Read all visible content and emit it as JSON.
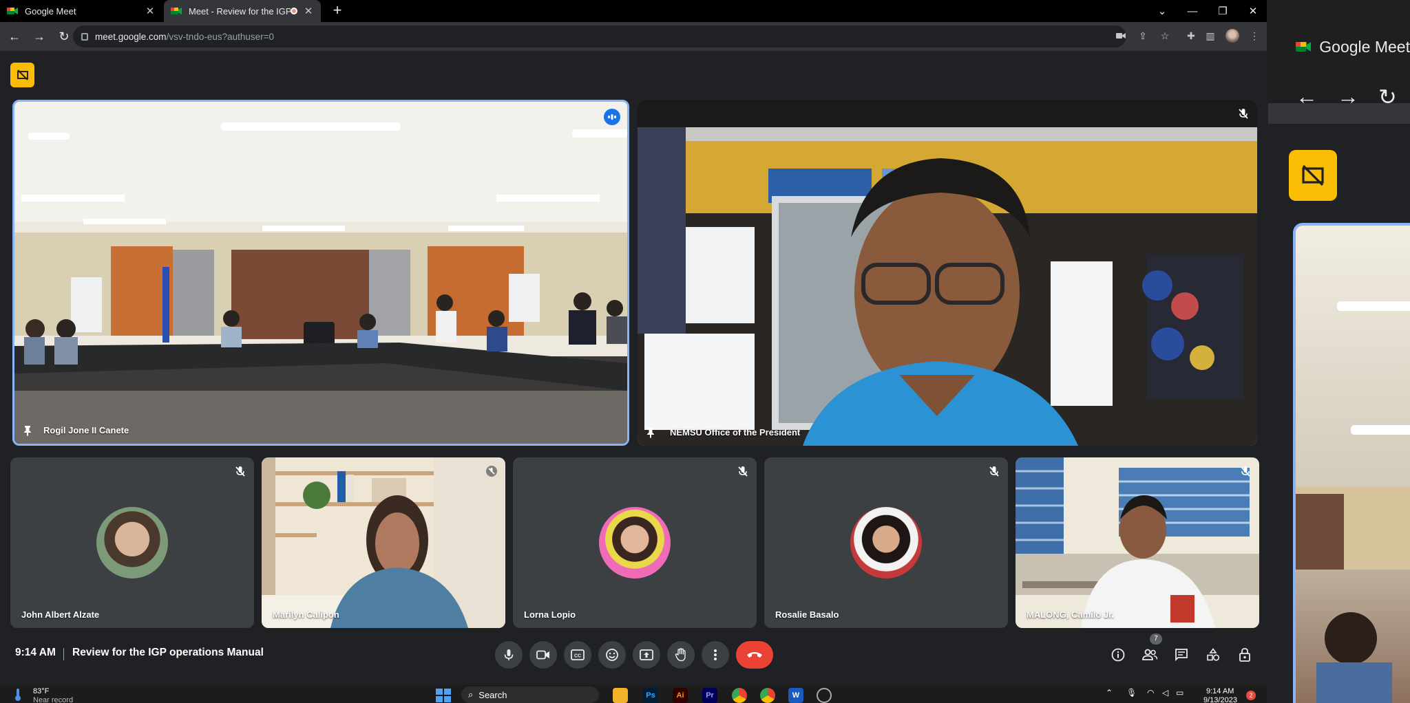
{
  "browser": {
    "tabs": [
      {
        "title": "Google Meet",
        "active": false
      },
      {
        "title": "Meet - Review for the IGP op",
        "active": true,
        "recording": true
      }
    ],
    "new_tab_label": "+",
    "url_host": "meet.google.com",
    "url_path": "/vsv-tndo-eus?authuser=0"
  },
  "meeting": {
    "time": "9:14 AM",
    "title": "Review for the IGP operations Manual",
    "participant_count": "7",
    "accent_color": "#8ab4f8",
    "end_call_color": "#ea4335",
    "presenting_chip_color": "#fbbc04",
    "participants_main": [
      {
        "name": "Rogil Jone II Canete",
        "pinned": true,
        "speaking": true
      },
      {
        "name": "NEMSU Office of the President",
        "pinned": true,
        "muted": true
      }
    ],
    "participants_row": [
      {
        "name": "John Albert Alzate",
        "muted": true,
        "video": false
      },
      {
        "name": "Marilyn Calipon",
        "muted": true,
        "video": true
      },
      {
        "name": "Lorna Lopio",
        "muted": true,
        "video": false
      },
      {
        "name": "Rosalie Basalo",
        "muted": true,
        "video": false
      },
      {
        "name": "MALONG, Camilo Jr.",
        "muted": true,
        "video": true
      }
    ]
  },
  "controls": [
    {
      "icon": "mic-icon"
    },
    {
      "icon": "camera-icon"
    },
    {
      "icon": "captions-icon"
    },
    {
      "icon": "emoji-icon"
    },
    {
      "icon": "present-screen-icon"
    },
    {
      "icon": "raise-hand-icon"
    },
    {
      "icon": "more-options-icon"
    },
    {
      "icon": "end-call-icon"
    }
  ],
  "right_controls": [
    {
      "icon": "info-icon"
    },
    {
      "icon": "people-icon"
    },
    {
      "icon": "chat-icon"
    },
    {
      "icon": "activities-icon"
    },
    {
      "icon": "host-controls-icon"
    }
  ],
  "taskbar": {
    "weather_temp": "83°F",
    "weather_desc": "Near record",
    "search_label": "Search",
    "clock_time": "9:14 AM",
    "clock_date": "9/13/2023",
    "notif_count": "2",
    "apps": [
      "Ps",
      "Ai",
      "Pr",
      "W"
    ]
  },
  "side_window": {
    "tab_title": "Google Meet"
  }
}
